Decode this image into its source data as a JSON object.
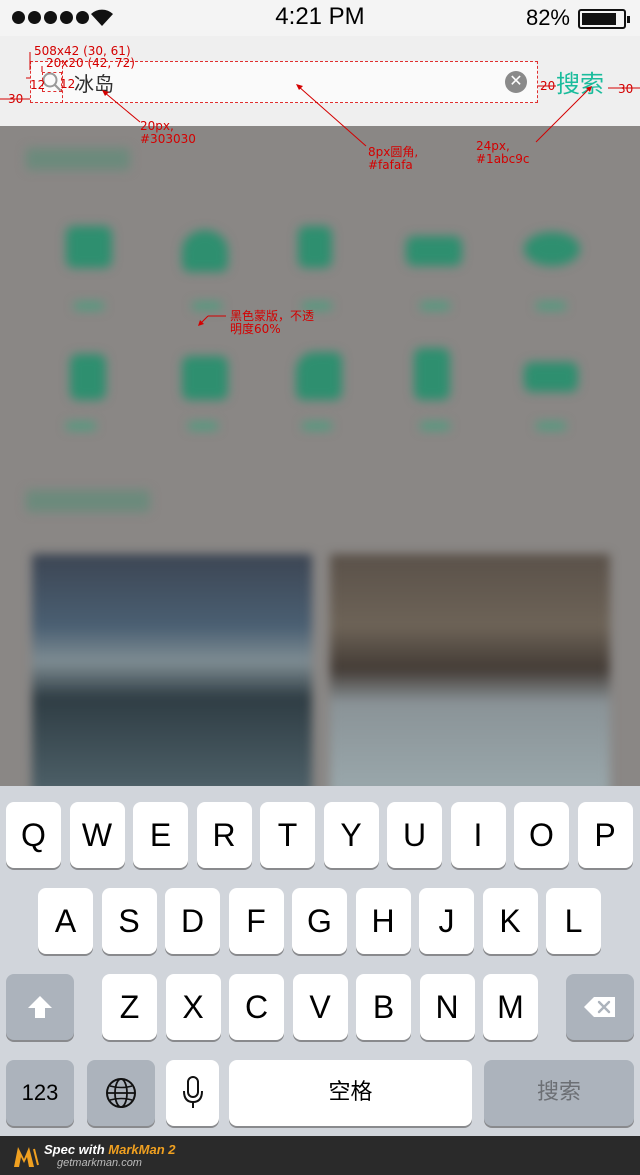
{
  "status_bar": {
    "time": "4:21 PM",
    "battery_percent": "82%",
    "battery_level": 0.82,
    "signal_dots": 5
  },
  "search": {
    "query": "冰岛",
    "search_button_label": "搜索",
    "accent_color": "#1abc9c",
    "text_color": "#303030",
    "box_color": "#fafafa"
  },
  "annotations": {
    "box_spec": "508x42 (30, 61)",
    "icon_spec": "20x20 (42, 72)",
    "pad_left": "12",
    "pad_icon": "12",
    "margin_left": "30",
    "gap_right": "20",
    "margin_right": "30",
    "text_note_1": "20px,",
    "text_note_2": "#303030",
    "box_note_1": "8px圆角,",
    "box_note_2": "#fafafa",
    "btn_note_1": "24px,",
    "btn_note_2": "#1abc9c",
    "overlay_note_1": "黑色蒙版，不透",
    "overlay_note_2": "明度60%"
  },
  "keyboard": {
    "row1": [
      "Q",
      "W",
      "E",
      "R",
      "T",
      "Y",
      "U",
      "I",
      "O",
      "P"
    ],
    "row2": [
      "A",
      "S",
      "D",
      "F",
      "G",
      "H",
      "J",
      "K",
      "L"
    ],
    "row3": [
      "Z",
      "X",
      "C",
      "V",
      "B",
      "N",
      "M"
    ],
    "numbers_key": "123",
    "space_key": "空格",
    "return_key": "搜索",
    "icons": [
      "shift-icon",
      "backspace-icon",
      "globe-icon",
      "microphone-icon"
    ]
  },
  "footer": {
    "title_prefix": "Spec with ",
    "title_brand": "MarkMan 2",
    "url": "getmarkman.com"
  }
}
